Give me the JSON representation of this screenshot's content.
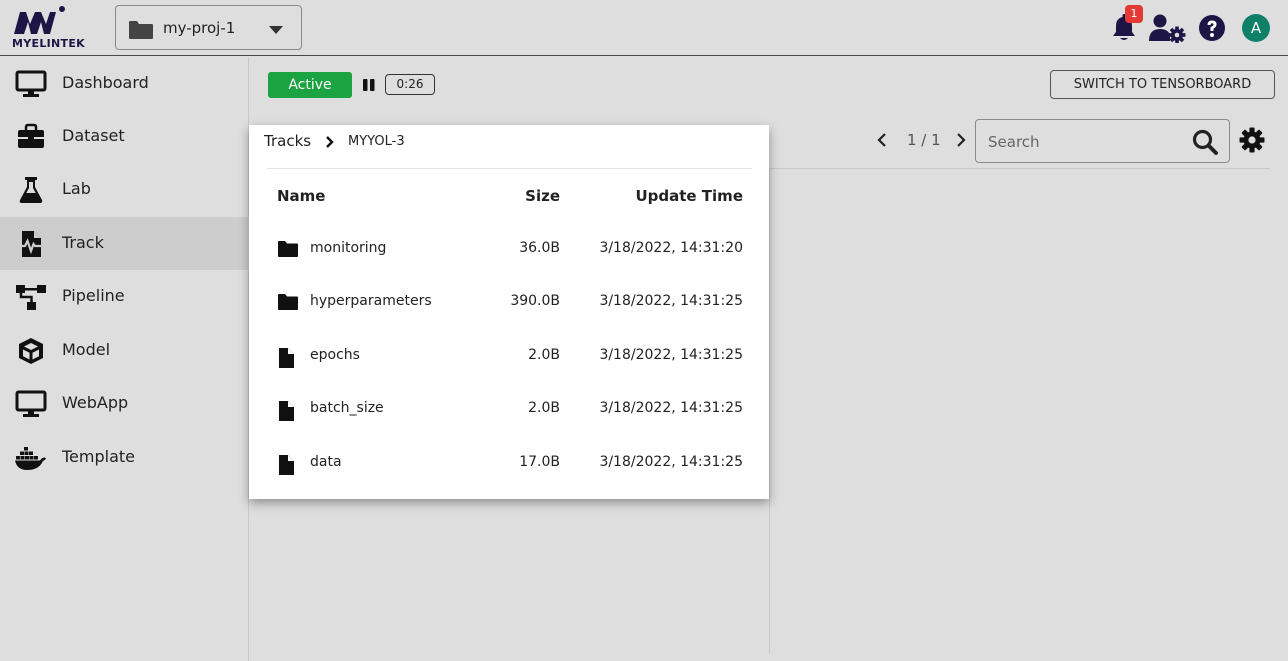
{
  "header": {
    "logo_text": "MYELINTEK",
    "project": "my-proj-1",
    "notification_count": "1",
    "avatar_initial": "A"
  },
  "sidebar": {
    "items": [
      {
        "label": "Dashboard",
        "icon": "monitor-icon"
      },
      {
        "label": "Dataset",
        "icon": "toolbox-icon"
      },
      {
        "label": "Lab",
        "icon": "flask-icon"
      },
      {
        "label": "Track",
        "icon": "file-waveform-icon"
      },
      {
        "label": "Pipeline",
        "icon": "pipeline-icon"
      },
      {
        "label": "Model",
        "icon": "cube-icon"
      },
      {
        "label": "WebApp",
        "icon": "monitor-icon"
      },
      {
        "label": "Template",
        "icon": "docker-icon"
      }
    ],
    "active": "Track"
  },
  "toolbar": {
    "status": "Active",
    "timer": "0:26",
    "tensorboard_label": "SWITCH TO TENSORBOARD"
  },
  "pager": {
    "text": "1 / 1"
  },
  "search": {
    "placeholder": "Search"
  },
  "popup": {
    "breadcrumb_root": "Tracks",
    "breadcrumb_current": "MYYOL-3",
    "columns": {
      "name": "Name",
      "size": "Size",
      "time": "Update Time"
    },
    "rows": [
      {
        "type": "folder",
        "name": "monitoring",
        "size": "36.0B",
        "time": "3/18/2022, 14:31:20"
      },
      {
        "type": "folder",
        "name": "hyperparameters",
        "size": "390.0B",
        "time": "3/18/2022, 14:31:25"
      },
      {
        "type": "file",
        "name": "epochs",
        "size": "2.0B",
        "time": "3/18/2022, 14:31:25"
      },
      {
        "type": "file",
        "name": "batch_size",
        "size": "2.0B",
        "time": "3/18/2022, 14:31:25"
      },
      {
        "type": "file",
        "name": "data",
        "size": "17.0B",
        "time": "3/18/2022, 14:31:25"
      }
    ]
  },
  "colors": {
    "active_green": "#1aa340",
    "brand_navy": "#1e1547",
    "avatar_teal": "#0f8068",
    "badge_red": "#e53935"
  }
}
